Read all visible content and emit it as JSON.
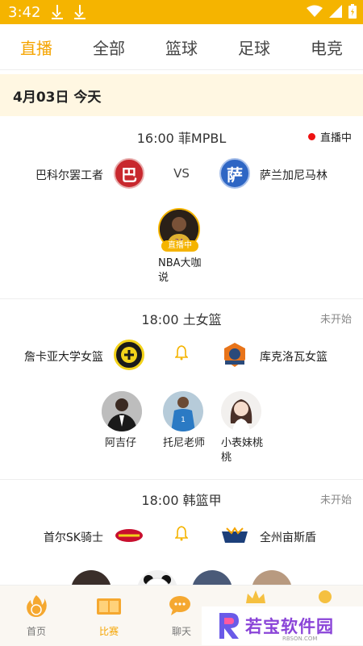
{
  "status_bar": {
    "time": "3:42"
  },
  "tabs": [
    {
      "label": "直播",
      "active": true
    },
    {
      "label": "全部",
      "active": false
    },
    {
      "label": "篮球",
      "active": false
    },
    {
      "label": "足球",
      "active": false
    },
    {
      "label": "电竞",
      "active": false
    }
  ],
  "date_header": "4月03日 今天",
  "matches": [
    {
      "time_league": "16:00 菲MPBL",
      "status": "直播中",
      "home": "巴科尔罢工者",
      "away": "萨兰加尼马林",
      "home_logo_char": "巴",
      "away_logo_char": "萨",
      "vs": "VS",
      "anchors": [
        {
          "name": "NBA大咖说",
          "badge": "直播中"
        }
      ]
    },
    {
      "time_league": "18:00 土女篮",
      "status": "未开始",
      "home": "詹卡亚大学女篮",
      "away": "库克洛瓦女篮",
      "anchors": [
        {
          "name": "阿吉仔"
        },
        {
          "name": "托尼老师"
        },
        {
          "name": "小表妹桃桃"
        }
      ]
    },
    {
      "time_league": "18:00 韩篮甲",
      "status": "未开始",
      "home": "首尔SK骑士",
      "away": "全州亩斯盾"
    }
  ],
  "bottom_nav": [
    {
      "label": "首页",
      "icon": "basketball-flame-icon",
      "active": false
    },
    {
      "label": "比赛",
      "icon": "scoreboard-icon",
      "active": true
    },
    {
      "label": "聊天",
      "icon": "chat-icon",
      "active": false
    }
  ],
  "watermark": {
    "text": "若宝软件园",
    "sub": "RBSON.COM"
  },
  "colors": {
    "accent": "#f5a400",
    "status_bar": "#f5b400",
    "live_dot": "#e11111",
    "date_bg": "#fff7e2"
  }
}
